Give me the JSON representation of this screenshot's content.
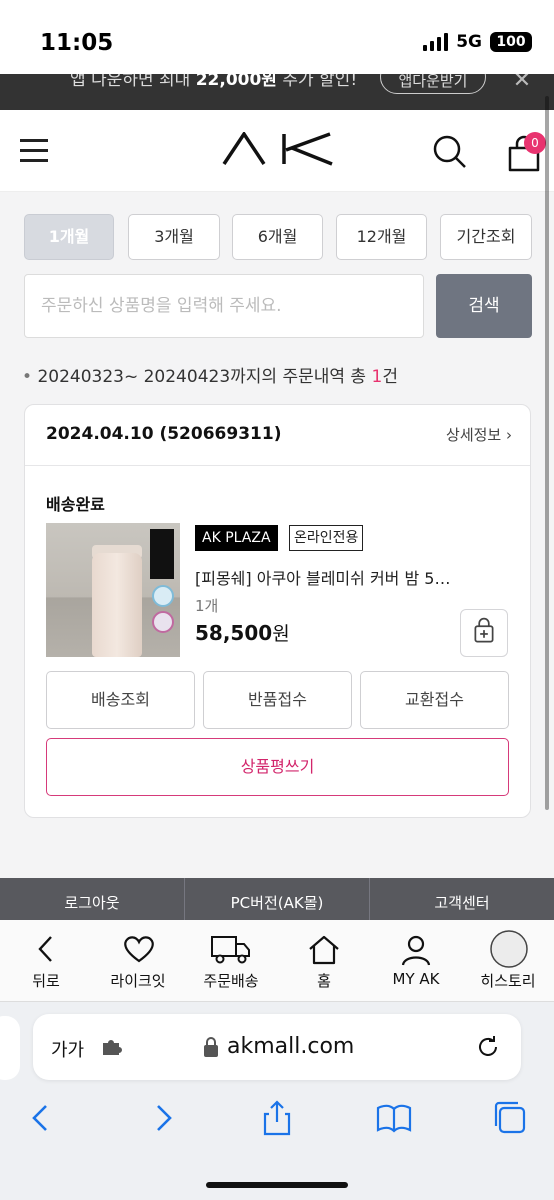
{
  "status_bar": {
    "time": "11:05",
    "network": "5G",
    "battery": "100"
  },
  "promo": {
    "text_pre": "앱 다운하면 최대 ",
    "text_bold": "22,000원",
    "text_post": " 추가 할인!",
    "button": "앱다운받기"
  },
  "header": {
    "logo": "AK",
    "cart_count": "0"
  },
  "period_tabs": [
    {
      "label": "1개월",
      "active": true
    },
    {
      "label": "3개월",
      "active": false
    },
    {
      "label": "6개월",
      "active": false
    },
    {
      "label": "12개월",
      "active": false
    },
    {
      "label": "기간조회",
      "active": false
    }
  ],
  "search": {
    "placeholder": "주문하신 상품명을 입력해 주세요.",
    "button": "검색"
  },
  "summary": {
    "bullet": "•",
    "text": "20240323~ 20240423까지의 주문내역 총 ",
    "count": "1",
    "unit": "건"
  },
  "order": {
    "date_id": "2024.04.10 (520669311)",
    "detail_link": "상세정보 ›",
    "status": "배송완료",
    "brand_tag": "AK PLAZA",
    "online_tag": "온라인전용",
    "product_name": "[피몽쉐] 아쿠아 블레미쉬 커버 밤 5…",
    "quantity": "1개",
    "price": "58,500",
    "price_unit": "원",
    "actions": [
      "배송조회",
      "반품접수",
      "교환접수"
    ],
    "review_button": "상품평쓰기"
  },
  "footer_menu": [
    "로그아웃",
    "PC버전(AK몰)",
    "고객센터"
  ],
  "bottom_nav": [
    {
      "label": "뒤로",
      "icon": "back-icon"
    },
    {
      "label": "라이크잇",
      "icon": "heart-icon"
    },
    {
      "label": "주문배송",
      "icon": "truck-icon"
    },
    {
      "label": "홈",
      "icon": "home-icon"
    },
    {
      "label": "MY AK",
      "icon": "person-icon"
    },
    {
      "label": "히스토리",
      "icon": "history-circle-icon"
    }
  ],
  "browser": {
    "text_size": "가가",
    "url": "akmall.com"
  },
  "colors": {
    "accent": "#e8336f",
    "search_button": "#6f7581",
    "footer": "#58595e",
    "promo_bg": "#333333"
  }
}
